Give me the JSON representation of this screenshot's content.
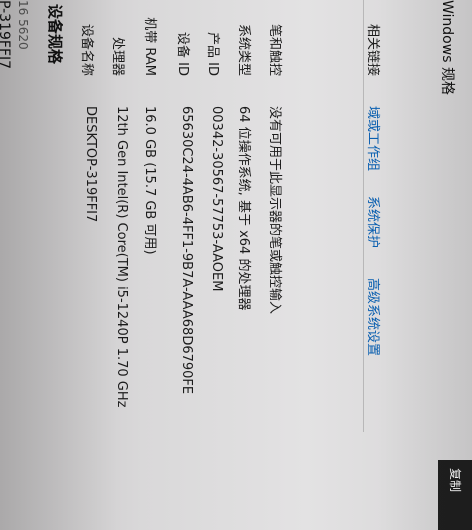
{
  "header": {
    "device_name": "P-319FFI7",
    "device_model": "16 5620",
    "section_title": "设备规格",
    "copy_button": "复制"
  },
  "specs": [
    {
      "label": "设备名称",
      "value": "DESKTOP-319FFI7"
    },
    {
      "label": "处理器",
      "value": "12th Gen Intel(R) Core(TM) i5-1240P   1.70 GHz"
    },
    {
      "label": "机带 RAM",
      "value": "16.0 GB (15.7 GB 可用)"
    },
    {
      "label": "设备 ID",
      "value": "65630C24-4AB6-4FF1-9B7A-AAA68D6790FE"
    },
    {
      "label": "产品 ID",
      "value": "00342-30567-57753-AAOEM"
    },
    {
      "label": "系统类型",
      "value": "64 位操作系统, 基于 x64 的处理器"
    },
    {
      "label": "笔和触控",
      "value": "没有可用于此显示器的笔或触控输入"
    }
  ],
  "related": {
    "label": "相关链接",
    "links": [
      "域或工作组",
      "系统保护",
      "高级系统设置"
    ]
  },
  "windows_specs": {
    "title": "Windows 规格"
  }
}
